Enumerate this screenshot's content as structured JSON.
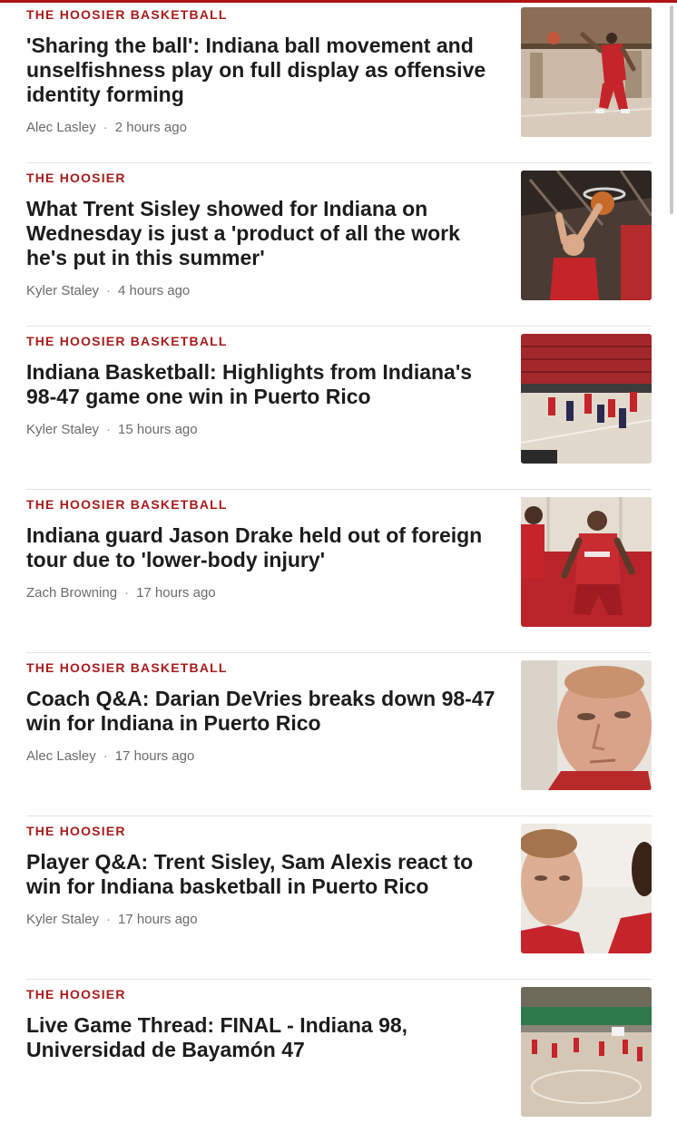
{
  "articles": [
    {
      "kicker": "THE HOOSIER BASKETBALL",
      "headline": "'Sharing the ball': Indiana ball movement and unselfishness play on full display as offensive identity forming",
      "author": "Alec Lasley",
      "time": "2 hours ago"
    },
    {
      "kicker": "THE HOOSIER",
      "headline": "What Trent Sisley showed for Indiana on Wednesday is just a 'product of all the work he's put in this summer'",
      "author": "Kyler Staley",
      "time": "4 hours ago"
    },
    {
      "kicker": "THE HOOSIER BASKETBALL",
      "headline": "Indiana Basketball: Highlights from Indiana's 98-47 game one win in Puerto Rico",
      "author": "Kyler Staley",
      "time": "15 hours ago"
    },
    {
      "kicker": "THE HOOSIER BASKETBALL",
      "headline": "Indiana guard Jason Drake held out of foreign tour due to 'lower-body injury'",
      "author": "Zach Browning",
      "time": "17 hours ago"
    },
    {
      "kicker": "THE HOOSIER BASKETBALL",
      "headline": "Coach Q&A: Darian DeVries breaks down 98-47 win for Indiana in Puerto Rico",
      "author": "Alec Lasley",
      "time": "17 hours ago"
    },
    {
      "kicker": "THE HOOSIER",
      "headline": "Player Q&A: Trent Sisley, Sam Alexis react to win for Indiana basketball in Puerto Rico",
      "author": "Kyler Staley",
      "time": "17 hours ago"
    },
    {
      "kicker": "THE HOOSIER",
      "headline": "Live Game Thread: FINAL - Indiana 98, Universidad de Bayamón 47",
      "author": "",
      "time": ""
    }
  ],
  "separator": "·",
  "colors": {
    "brand_red": "#a81b1b",
    "headline": "#1c1c1c",
    "byline": "#6b6b6b"
  }
}
